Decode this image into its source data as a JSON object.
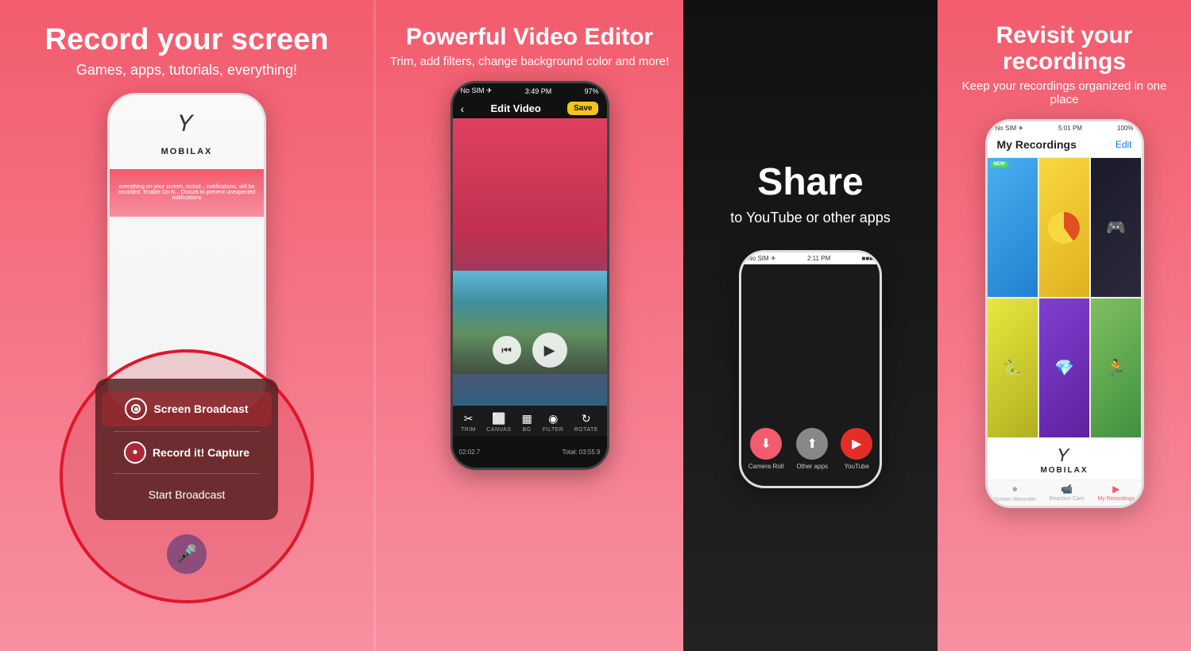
{
  "panel1": {
    "headline": "Record your screen",
    "subheadline": "Games, apps, tutorials, everything!",
    "logo_text": "MOBILAX",
    "broadcast_items": [
      {
        "label": "Screen Broadcast",
        "type": "screen"
      },
      {
        "label": "Record it! Capture",
        "type": "record"
      }
    ],
    "start_label": "Start Broadcast"
  },
  "panel2": {
    "headline": "Powerful Video Editor",
    "subheadline": "Trim, add filters, change background color and more!",
    "status_left": "No SIM ✈",
    "status_time": "3:49 PM",
    "status_right": "97%",
    "header_title": "Edit Video",
    "save_label": "Save",
    "toolbar_items": [
      {
        "icon": "✂",
        "label": "TRIM"
      },
      {
        "icon": "⬜",
        "label": "CANVAS"
      },
      {
        "icon": "▦",
        "label": "BG"
      },
      {
        "icon": "◉",
        "label": "FILTER"
      },
      {
        "icon": "↻",
        "label": "ROTATE"
      }
    ],
    "time_start": "02:02.7",
    "time_total": "Total: 03:55.9"
  },
  "panel3": {
    "share_title": "Share",
    "share_sub": "to YouTube or other apps",
    "share_status_left": "No SIM ✈",
    "share_status_time": "2:11 PM",
    "share_icons": [
      {
        "label": "Camera Roll",
        "color": "#f25c6e",
        "icon": "⬇"
      },
      {
        "label": "Other apps",
        "color": "#888",
        "icon": "⬆"
      },
      {
        "label": "YouTube",
        "color": "#e52d27",
        "icon": "▶"
      }
    ]
  },
  "panel4": {
    "headline": "Revisit your recordings",
    "subheadline": "Keep your recordings organized in\none place",
    "status_left": "No SIM ✈",
    "status_time": "5:01 PM",
    "status_right": "100%",
    "header_title": "My Recordings",
    "edit_label": "Edit",
    "logo_text": "MOBILAX",
    "tabs": [
      {
        "icon": "⏺",
        "label": "Screen Recorder",
        "active": false
      },
      {
        "icon": "📹",
        "label": "Reaction Cam",
        "active": false
      },
      {
        "icon": "▶",
        "label": "My Recordings",
        "active": true
      }
    ]
  }
}
